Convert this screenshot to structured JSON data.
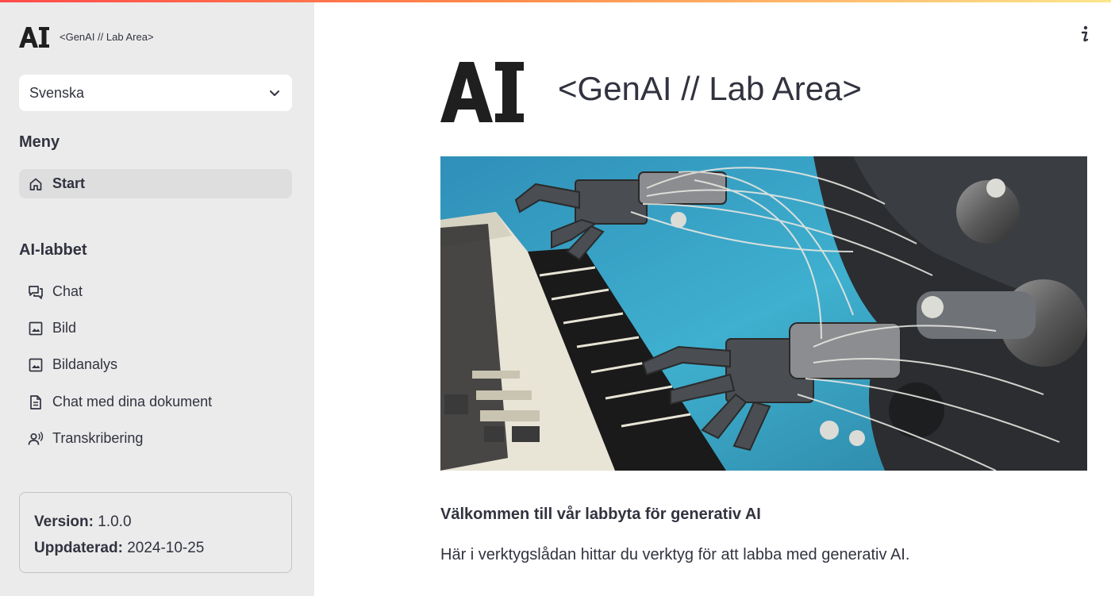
{
  "top_bar": {
    "gradient_colors": [
      "#ff4b4b",
      "#ff8a4b",
      "#fde68a"
    ]
  },
  "sidebar": {
    "logo_text": "AI",
    "app_title": "<GenAI // Lab Area>",
    "language_select": {
      "value": "Svenska",
      "icon": "chevron-down-icon"
    },
    "menu_heading": "Meny",
    "menu_items": [
      {
        "label": "Start",
        "icon": "home-icon",
        "active": true
      }
    ],
    "lab_heading": "AI-labbet",
    "lab_items": [
      {
        "label": "Chat",
        "icon": "chat-bubbles-icon"
      },
      {
        "label": "Bild",
        "icon": "image-icon"
      },
      {
        "label": "Bildanalys",
        "icon": "image-icon"
      },
      {
        "label": "Chat med dina dokument",
        "icon": "document-icon"
      },
      {
        "label": "Transkribering",
        "icon": "voice-user-icon"
      }
    ],
    "info": {
      "version_label": "Version:",
      "version_value": "1.0.0",
      "updated_label": "Uppdaterad:",
      "updated_value": "2024-10-25"
    }
  },
  "main": {
    "info_icon": "info-icon",
    "logo_text": "AI",
    "title": "<GenAI // Lab Area>",
    "hero_image": "robot-hands-playing-piano-image",
    "welcome_heading": "Välkommen till vår labbyta för generativ AI",
    "description": "Här i verktygslådan hittar du verktyg för att labba med generativ AI."
  },
  "colors": {
    "sidebar_bg": "#ebebeb",
    "active_item_bg": "#dedede",
    "text": "#31333f",
    "accent": "#ff4b4b"
  }
}
